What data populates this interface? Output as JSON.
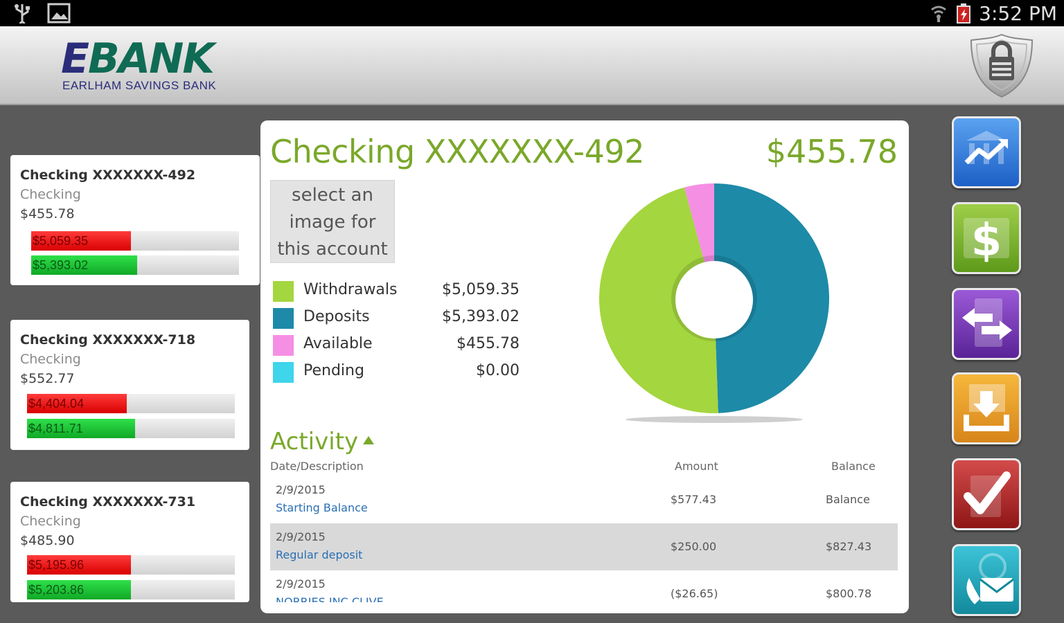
{
  "status_bar": {
    "time": "3:52 PM",
    "icons": [
      "usb-icon",
      "gallery-icon",
      "wifi-icon",
      "battery-icon"
    ]
  },
  "header": {
    "logo_e": "E",
    "logo_rest": "BANK",
    "logo_subtitle": "EARLHAM SAVINGS BANK",
    "lock_button_icon": "lock-icon"
  },
  "accounts": [
    {
      "name": "Checking XXXXXXX-492",
      "type": "Checking",
      "balance": "$455.78",
      "withdrawals": "$5,059.35",
      "deposits": "$5,393.02",
      "withdrawals_fraction": 0.48,
      "deposits_fraction": 0.51
    },
    {
      "name": "Checking XXXXXXX-718",
      "type": "Checking",
      "balance": "$552.77",
      "withdrawals": "$4,404.04",
      "deposits": "$4,811.71",
      "withdrawals_fraction": 0.48,
      "deposits_fraction": 0.52
    },
    {
      "name": "Checking XXXXXXX-731",
      "type": "Checking",
      "balance": "$485.90",
      "withdrawals": "$5,195.96",
      "deposits": "$5,203.86",
      "withdrawals_fraction": 0.5,
      "deposits_fraction": 0.5
    }
  ],
  "main": {
    "title": "Checking XXXXXXX-492",
    "amount": "$455.78",
    "select_image_text": [
      "select an",
      "image for",
      "this account"
    ],
    "legend": [
      {
        "label": "Withdrawals",
        "value": "$5,059.35",
        "color": "#a4d63f"
      },
      {
        "label": "Deposits",
        "value": "$5,393.02",
        "color": "#1d8aa8"
      },
      {
        "label": "Available",
        "value": "$455.78",
        "color": "#f58fe3"
      },
      {
        "label": "Pending",
        "value": "$0.00",
        "color": "#3fd5eb"
      }
    ],
    "activity": {
      "title": "Activity",
      "columns": {
        "desc": "Date/Description",
        "amount": "Amount",
        "balance": "Balance"
      },
      "rows": [
        {
          "date": "2/9/2015",
          "description": "Starting Balance",
          "amount": "$577.43",
          "balance": "Balance"
        },
        {
          "date": "2/9/2015",
          "description": "Regular deposit",
          "amount": "$250.00",
          "balance": "$827.43"
        },
        {
          "date": "2/9/2015",
          "description": "NORRIES INC CLIVE",
          "amount": "($26.65)",
          "balance": "$800.78"
        }
      ]
    }
  },
  "chart_data": {
    "type": "pie",
    "categories": [
      "Withdrawals",
      "Deposits",
      "Available",
      "Pending"
    ],
    "values": [
      5059.35,
      5393.02,
      455.78,
      0.0
    ],
    "colors": [
      "#a4d63f",
      "#1d8aa8",
      "#f58fe3",
      "#3fd5eb"
    ],
    "title": "",
    "donut": true
  },
  "rail": [
    {
      "name": "accounts-icon",
      "colors": [
        "#5aa2f0",
        "#1d5fc6"
      ]
    },
    {
      "name": "dollar-icon",
      "colors": [
        "#9fce4a",
        "#5e9a1a"
      ]
    },
    {
      "name": "transfer-icon",
      "colors": [
        "#9b59d6",
        "#5a2397"
      ]
    },
    {
      "name": "deposit-icon",
      "colors": [
        "#f6b73c",
        "#d7851a"
      ]
    },
    {
      "name": "bill-pay-icon",
      "colors": [
        "#d34b4b",
        "#8f1616"
      ]
    },
    {
      "name": "contact-icon",
      "colors": [
        "#3cc3d8",
        "#13899c"
      ]
    }
  ]
}
